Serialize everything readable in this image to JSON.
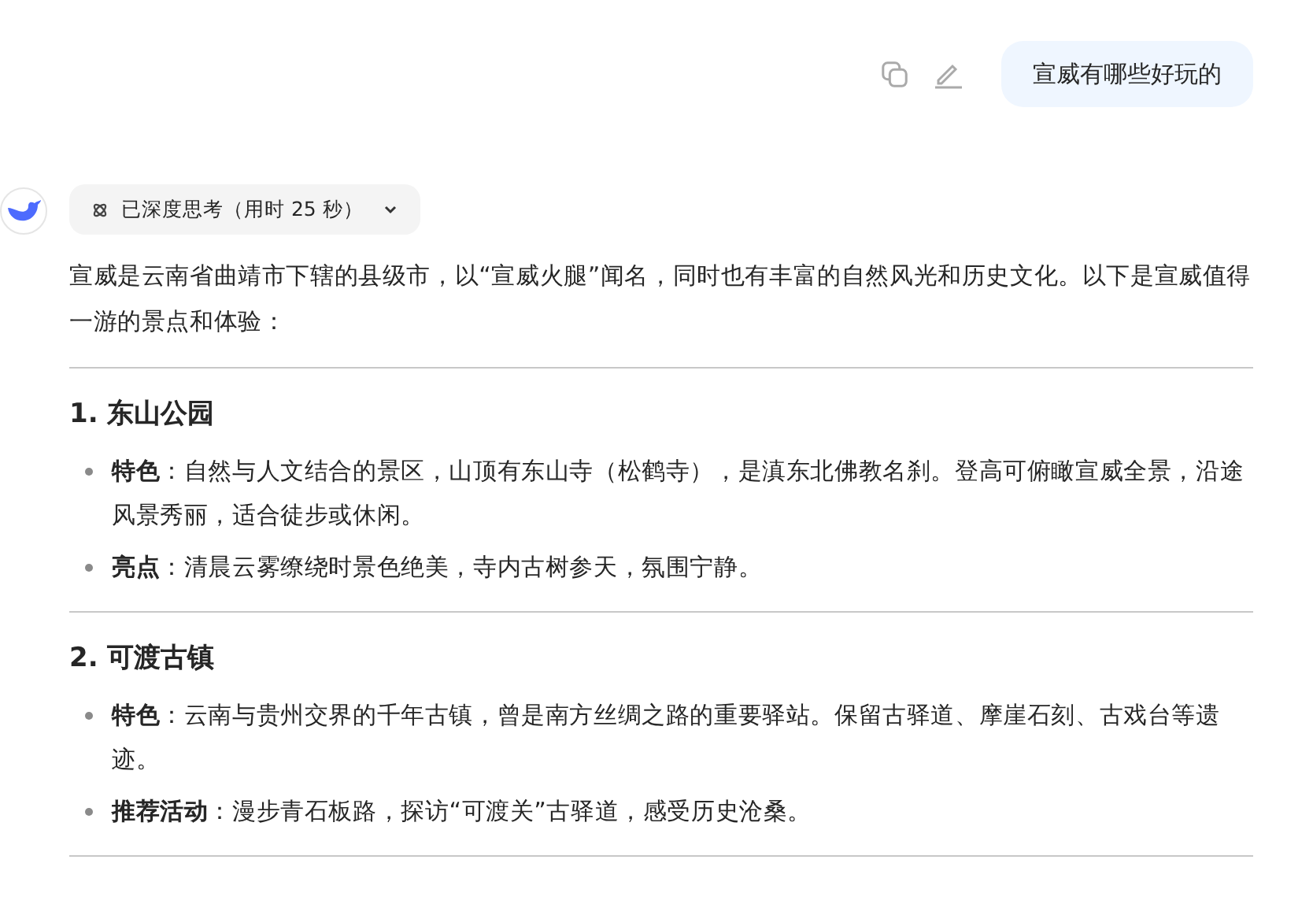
{
  "user_message": {
    "text": "宣威有哪些好玩的"
  },
  "thinking": {
    "label": "已深度思考（用时 25 秒）",
    "expanded": false
  },
  "answer": {
    "intro": "宣威是云南省曲靖市下辖的县级市，以“宣威火腿”闻名，同时也有丰富的自然风光和历史文化。以下是宣威值得一游的景点和体验：",
    "sections": [
      {
        "heading": "1. 东山公园",
        "bullets": [
          "**特色**：自然与人文结合的景区，山顶有东山寺（松鹤寺），是滇东北佛教名刹。登高可俯瞰宣威全景，沿途风景秀丽，适合徒步或休闲。",
          "**亮点**：清晨云雾缭绕时景色绝美，寺内古树参天，氛围宁静。"
        ]
      },
      {
        "heading": "2. 可渡古镇",
        "bullets": [
          "**特色**：云南与贵州交界的千年古镇，曾是南方丝绸之路的重要驿站。保留古驿道、摩崖石刻、古戏台等遗迹。",
          "**推荐活动**：漫步青石板路，探访“可渡关”古驿道，感受历史沧桑。"
        ]
      }
    ]
  }
}
